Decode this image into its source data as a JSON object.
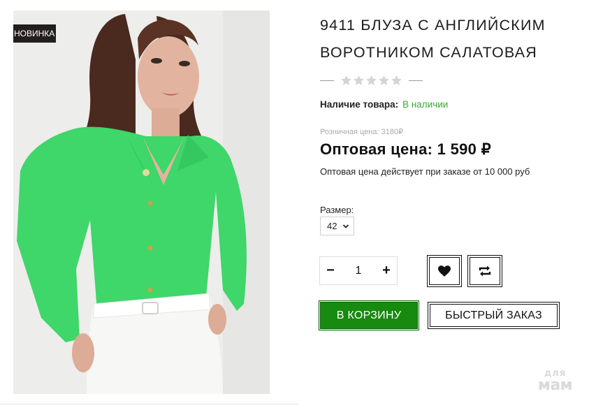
{
  "product": {
    "badge": "НОВИНКА",
    "title": "9411 Блуза с английским воротником салатовая",
    "rating_stars": 5,
    "rating_value": 0,
    "availability_label": "Наличие товара:",
    "availability_value": "В наличии",
    "retail_price": "Розничная цена: 3180₽",
    "wholesale_price": "Оптовая цена: 1 590 ₽",
    "wholesale_note": "Оптовая цена действует при заказе от 10 000 руб",
    "size_label": "Размер:",
    "size_selected": "42"
  },
  "quantity": {
    "minus": "−",
    "value": "1",
    "plus": "+"
  },
  "actions": {
    "favorite_icon": "heart-icon",
    "compare_icon": "compare-arrows-icon",
    "cart_label": "В КОРЗИНУ",
    "quick_order_label": "БЫСТРЫЙ ЗАКАЗ"
  },
  "watermark": {
    "line1": "для",
    "line2": "мам"
  },
  "colors": {
    "cart_green": "#178a10",
    "in_stock_green": "#3aa935",
    "badge_bg": "#231f20",
    "blouse_green": "#3fd66a"
  }
}
